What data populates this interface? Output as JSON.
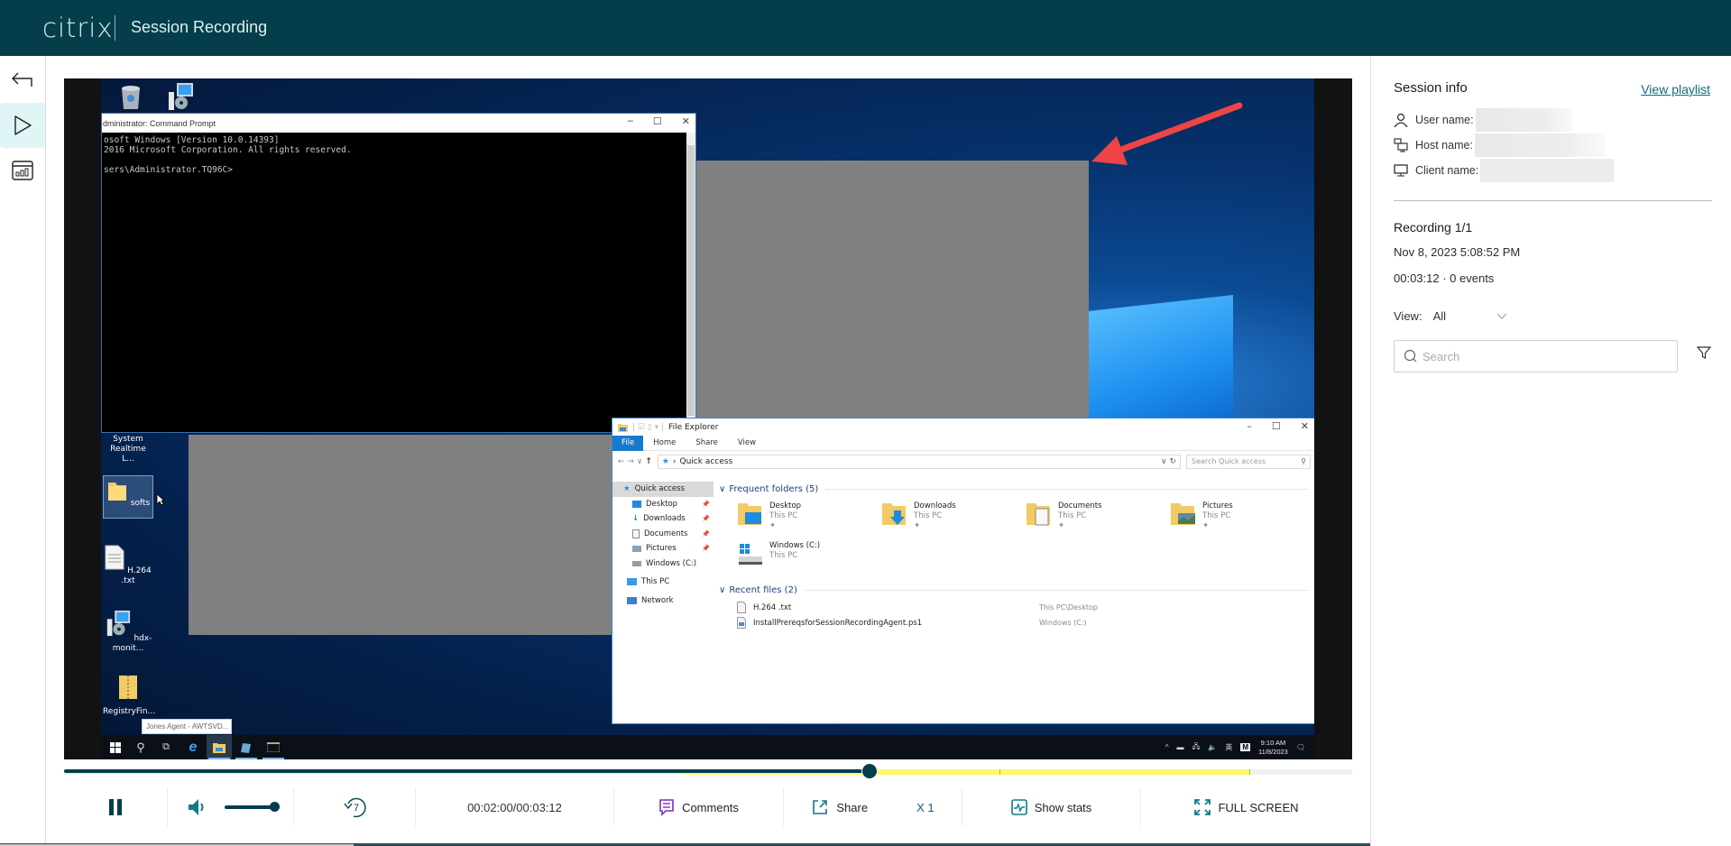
{
  "header": {
    "logo": "citrix",
    "title": "Session Recording"
  },
  "leftnav": {
    "items": [
      {
        "name": "back",
        "icon": "back-arrow-icon",
        "active": false
      },
      {
        "name": "player",
        "icon": "play-icon",
        "active": true
      },
      {
        "name": "stats",
        "icon": "dashboard-icon",
        "active": false
      }
    ]
  },
  "recording_view": {
    "desktop_icons": [
      {
        "label": "",
        "icon": "recycle-bin-icon"
      },
      {
        "label": "",
        "icon": "installer-icon"
      },
      {
        "label": "System Realtime L...",
        "icon": "app-icon"
      },
      {
        "label": "softs",
        "icon": "folder-icon"
      },
      {
        "label": "H.264 .txt",
        "icon": "text-file-icon"
      },
      {
        "label": "hdx-monit...",
        "icon": "installer-icon"
      },
      {
        "label": "RegistryFin...",
        "icon": "zip-folder-icon"
      }
    ],
    "taskbar_tooltip": "Jones Agent - AWTSVD...",
    "cmd_window": {
      "title": "dministrator: Command Prompt",
      "lines": [
        "osoft Windows [Version 10.0.14393]",
        "2016 Microsoft Corporation. All rights reserved.",
        "",
        "sers\\Administrator.TQ96C>"
      ]
    },
    "explorer": {
      "title": "File Explorer",
      "ribbon_tabs": [
        "File",
        "Home",
        "Share",
        "View"
      ],
      "address": "Quick access",
      "search_placeholder": "Search Quick access",
      "nav": {
        "quick_access": "Quick access",
        "pinned": [
          "Desktop",
          "Downloads",
          "Documents",
          "Pictures"
        ],
        "drive": "Windows (C:)",
        "this_pc": "This PC",
        "network": "Network"
      },
      "frequent_header": "Frequent folders (5)",
      "frequent": [
        {
          "name": "Desktop",
          "loc": "This PC",
          "pinned": true
        },
        {
          "name": "Downloads",
          "loc": "This PC",
          "pinned": true
        },
        {
          "name": "Documents",
          "loc": "This PC",
          "pinned": true
        },
        {
          "name": "Pictures",
          "loc": "This PC",
          "pinned": true
        },
        {
          "name": "Windows (C:)",
          "loc": "This PC",
          "pinned": false
        }
      ],
      "recent_header": "Recent files (2)",
      "recent": [
        {
          "name": "H.264 .txt",
          "loc": "This PC\\Desktop"
        },
        {
          "name": "InstallPrereqsforSessionRecordingAgent.ps1",
          "loc": "Windows (C:)"
        }
      ]
    },
    "tray": {
      "ime": "英",
      "m": "M",
      "time": "9:10 AM",
      "date": "11/8/2023"
    }
  },
  "player": {
    "progress": 0.625,
    "event_markers": [
      {
        "start": 0.48,
        "end": 0.726
      },
      {
        "start": 0.726,
        "end": 0.92
      }
    ],
    "volume": 1.0,
    "skip_seconds": "7",
    "time": "00:02:00/00:03:12",
    "comments_label": "Comments",
    "share_label": "Share",
    "speed_label": "X 1",
    "stats_label": "Show stats",
    "fullscreen_label": "FULL SCREEN"
  },
  "session_info": {
    "title": "Session info",
    "view_playlist": "View playlist",
    "user_label": "User name:",
    "host_label": "Host name:",
    "client_label": "Client name:",
    "recording_title": "Recording 1/1",
    "recording_date": "Nov 8, 2023 5:08:52 PM",
    "duration_events": "00:03:12 · 0 events",
    "view_label": "View:",
    "view_value": "All",
    "search_placeholder": "Search"
  },
  "colors": {
    "brand": "#043e4b",
    "link": "#0f6a7c",
    "event_marker": "#fff86a",
    "comments_icon": "#7b2fbf",
    "accent_icon": "#117a8b"
  }
}
